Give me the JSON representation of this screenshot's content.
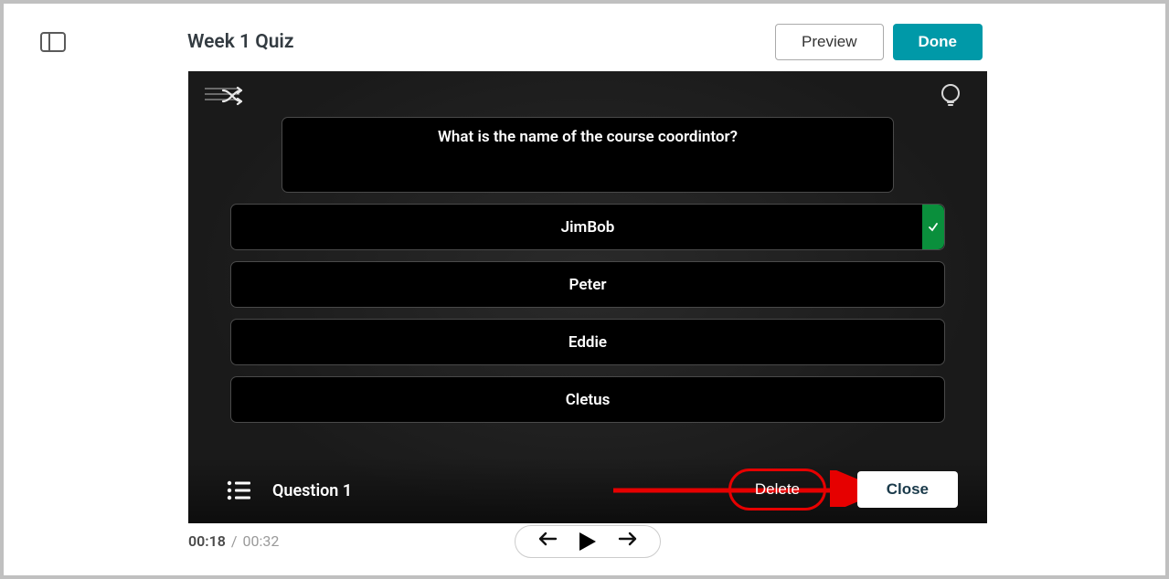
{
  "header": {
    "title": "Week 1 Quiz",
    "preview_label": "Preview",
    "done_label": "Done"
  },
  "quiz": {
    "question_text": "What is the name of the course coordintor?",
    "answers": [
      {
        "label": "JimBob",
        "correct": true
      },
      {
        "label": "Peter",
        "correct": false
      },
      {
        "label": "Eddie",
        "correct": false
      },
      {
        "label": "Cletus",
        "correct": false
      }
    ],
    "question_indicator": "Question 1",
    "delete_label": "Delete",
    "close_label": "Close"
  },
  "timeline": {
    "current": "00:18",
    "total": "00:32"
  }
}
